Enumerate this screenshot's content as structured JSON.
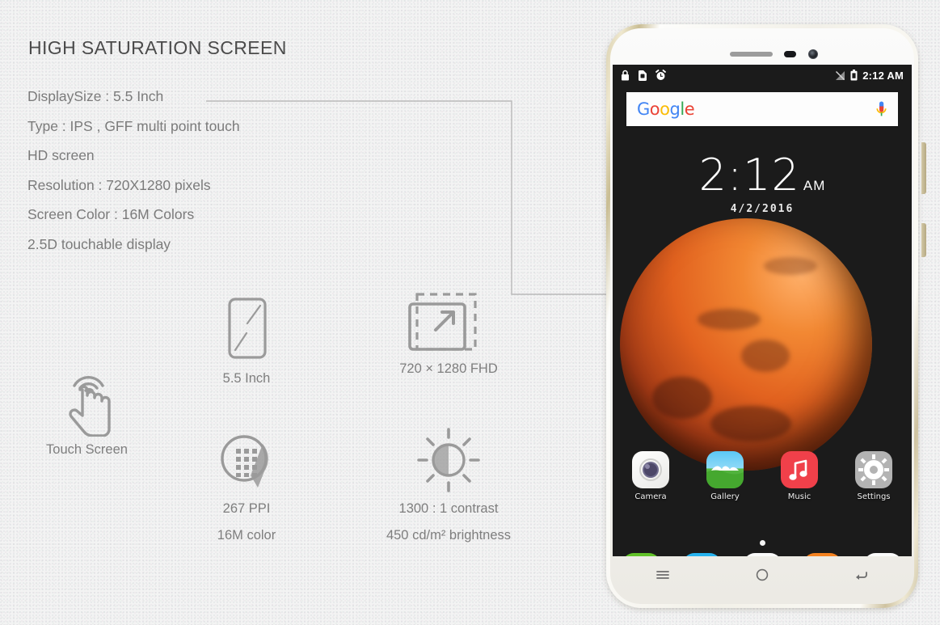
{
  "panel": {
    "title": "HIGH SATURATION SCREEN",
    "specs": [
      "DisplaySize : 5.5 Inch",
      "Type : IPS , GFF multi point touch",
      "HD screen",
      "Resolution : 720X1280 pixels",
      "Screen Color : 16M  Colors",
      "2.5D touchable display"
    ]
  },
  "features": [
    {
      "id": "touch",
      "icon": "touch-screen-icon",
      "lines": [
        "Touch Screen"
      ]
    },
    {
      "id": "size",
      "icon": "screen-diagonal-icon",
      "lines": [
        "5.5 Inch"
      ]
    },
    {
      "id": "res",
      "icon": "resolution-expand-icon",
      "lines": [
        "720 × 1280 FHD"
      ]
    },
    {
      "id": "ppi",
      "icon": "pixel-density-icon",
      "lines": [
        "267 PPI",
        "16M color"
      ]
    },
    {
      "id": "bright",
      "icon": "brightness-sun-icon",
      "lines": [
        "1300 : 1 contrast",
        "450 cd/m² brightness"
      ]
    }
  ],
  "phone": {
    "status_bar": {
      "left_icons": [
        "lock-icon",
        "sim-card-icon",
        "alarm-clock-icon"
      ],
      "right_icons": [
        "signal-off-icon",
        "battery-icon"
      ],
      "clock": "2:12 AM"
    },
    "search": {
      "logo": "Google",
      "logo_letters": [
        "G",
        "o",
        "o",
        "g",
        "l",
        "e"
      ],
      "mic_icon": "microphone-icon"
    },
    "clock_widget": {
      "time": "2:12",
      "ampm": "AM",
      "date": "4/2/2016"
    },
    "apps": [
      {
        "label": "Camera",
        "icon": "camera-app-icon",
        "color": "#f7f7f5"
      },
      {
        "label": "Gallery",
        "icon": "gallery-app-icon",
        "color": "#4fc3f7"
      },
      {
        "label": "Music",
        "icon": "music-app-icon",
        "color": "#f0404a"
      },
      {
        "label": "Settings",
        "icon": "settings-app-icon",
        "color": "#b3b3b3"
      }
    ],
    "dock": [
      {
        "icon": "phone-dialer-icon",
        "color": "#62c229"
      },
      {
        "icon": "messages-icon",
        "color": "#27b3ef"
      },
      {
        "icon": "app-drawer-icon",
        "color": "#fafafa"
      },
      {
        "icon": "contacts-icon",
        "color": "#f58220"
      },
      {
        "icon": "browser-globe-icon",
        "color": "#fafafa"
      }
    ],
    "nav_buttons": [
      "menu-icon",
      "home-icon",
      "back-icon"
    ],
    "page_indicator_count": 1
  },
  "colors": {
    "background": "#f3f3f3",
    "title_text": "#4b4b4b",
    "body_text": "#7b7b7b",
    "icon_stroke": "#9a9a9a",
    "callout_line": "#b4b4b4",
    "callout_dot": "#111111",
    "screen_bg": "#1b1b1b",
    "planet": "#e2621f",
    "frame_gold": "#cfc5a6"
  }
}
